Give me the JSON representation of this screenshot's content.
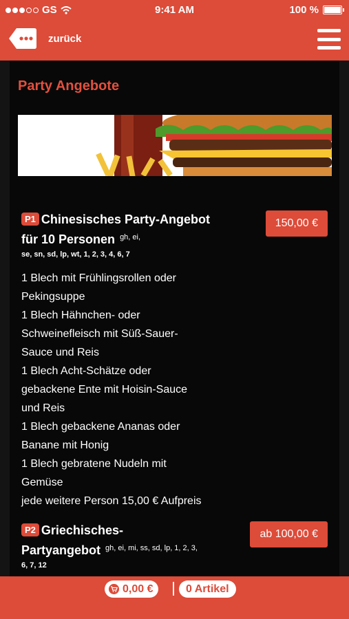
{
  "status_bar": {
    "carrier": "GS",
    "time": "9:41 AM",
    "battery": "100 %",
    "battery_level": 1.0
  },
  "nav": {
    "back_label": "zurück"
  },
  "section": {
    "title": "Party Angebote"
  },
  "items": [
    {
      "code": "P1",
      "name": "Chinesisches Party-Angebot für 10 Personen",
      "allergens_first": "gh, ei,",
      "allergens_rest": "se, sn, sd, lp, wt, 1, 2, 3, 4, 6, 7",
      "price": "150,00 €",
      "description": "1 Blech mit Frühlingsrollen oder\nPekingsuppe\n1 Blech Hähnchen- oder\nSchweinefleisch mit Süß-Sauer-\nSauce und Reis\n1 Blech Acht-Schätze oder\ngebackene Ente mit Hoisin-Sauce\nund Reis\n1 Blech gebackene Ananas oder\nBanane mit Honig\n1 Blech gebratene Nudeln mit\nGemüse\njede weitere Person 15,00 € Aufpreis"
    },
    {
      "code": "P2",
      "name_line1": "Griechisches-",
      "name_line2": "Partyangebot",
      "allergens_first": "gh, ei, mi, ss, sd, lp, 1, 2, 3,",
      "allergens_rest": "6, 7, 12",
      "price": "ab 100,00 €"
    }
  ],
  "bottom_bar": {
    "cart_total": "0,00 €",
    "article_count": "0 Artikel"
  },
  "colors": {
    "accent": "#dd4b39",
    "title_red": "#e3503e",
    "background": "#080808"
  },
  "icons": [
    "wifi-icon",
    "back-icon",
    "menu-icon",
    "cart-icon",
    "battery-icon",
    "signal-icon"
  ]
}
